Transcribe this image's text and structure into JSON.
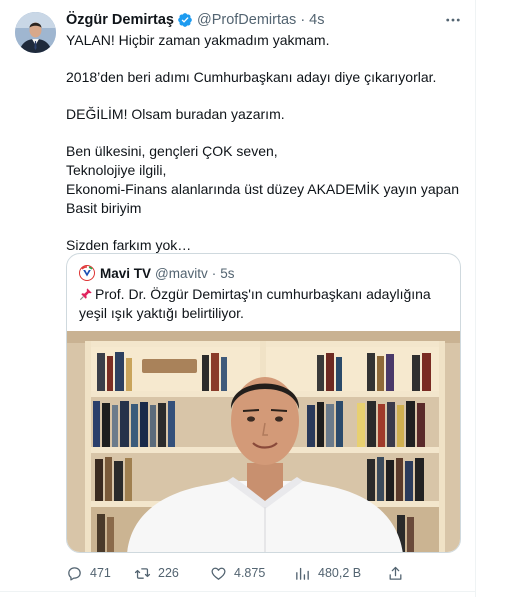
{
  "tweet": {
    "author_name": "Özgür Demirtaş",
    "author_handle": "@ProfDemirtas",
    "separator": "·",
    "time": "4s",
    "lines": [
      "YALAN! Hiçbir zaman yakmadım yakmam.",
      "",
      "2018’den beri adımı Cumhurbaşkanı adayı diye çıkarıyorlar.",
      "",
      "DEĞİLİM! Olsam buradan yazarım.",
      "",
      "Ben ülkesini, gençleri ÇOK seven,",
      "Teknolojiye ilgili,",
      "Ekonomi-Finans alanlarında üst düzey AKADEMİK yayın yapan",
      "Basit biriyim",
      "",
      "Sizden farkım yok…"
    ]
  },
  "quote": {
    "author_name": "Mavi TV",
    "author_handle": "@mavitv",
    "separator": "·",
    "time": "5s",
    "text": "Prof. Dr. Özgür Demirtaş'ın cumhurbaşkanı adaylığına yeşil ışık yaktığı belirtiliyor."
  },
  "actions": {
    "replies": "471",
    "retweets": "226",
    "likes": "4.875",
    "views": "480,2 B"
  },
  "icons": {
    "verified": "verified-badge-icon",
    "more": "more-horizontal-icon",
    "pin": "pushpin-icon",
    "reply": "reply-icon",
    "retweet": "retweet-icon",
    "like": "heart-icon",
    "views": "views-chart-icon",
    "share": "share-icon"
  },
  "colors": {
    "verified_blue": "#1d9bf0",
    "secondary_text": "#536471",
    "border": "#cfd9de"
  }
}
